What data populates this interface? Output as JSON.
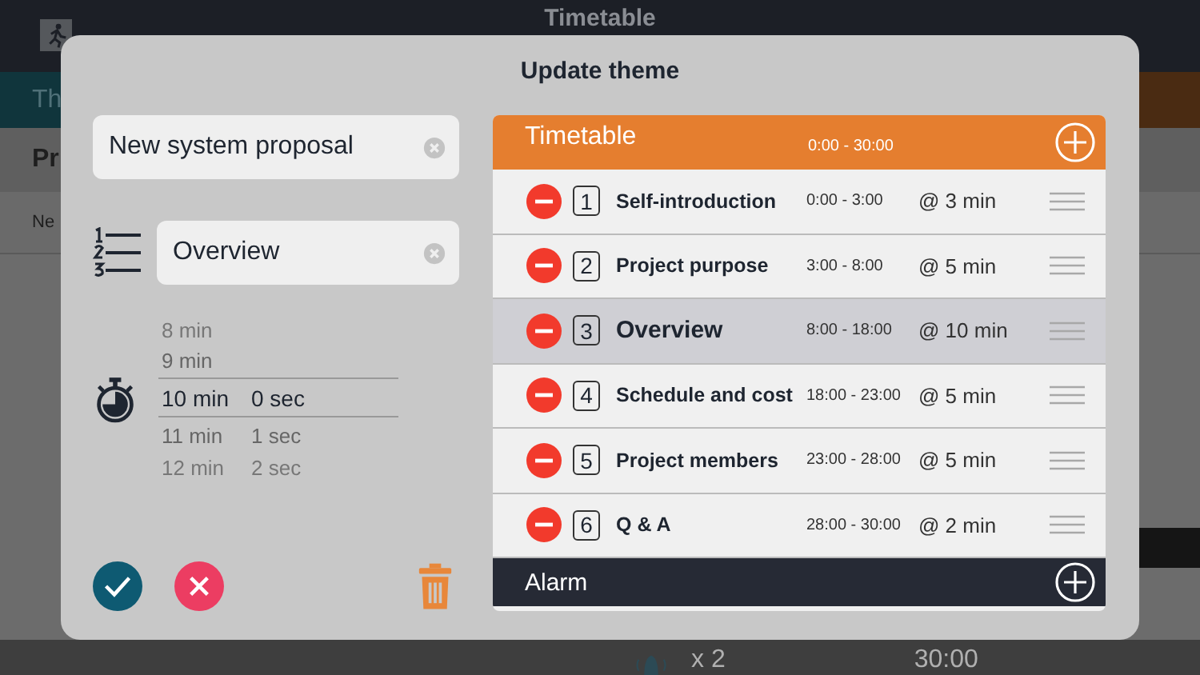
{
  "background": {
    "title": "Timetable",
    "tab": "Th",
    "row_title": "Pr",
    "row_text": "Ne",
    "footer": {
      "count": "x 2",
      "time": "30:00"
    }
  },
  "dialog": {
    "title": "Update theme",
    "name_field": {
      "value": "New system proposal"
    },
    "section_field": {
      "value": "Overview"
    },
    "picker": [
      {
        "minutes": "8 min",
        "selected": false
      },
      {
        "minutes": "9 min",
        "selected": false
      },
      {
        "minutes": "10 min",
        "seconds": "0 sec",
        "selected": true
      },
      {
        "minutes": "11 min",
        "seconds": "1 sec",
        "selected": false
      },
      {
        "minutes": "12 min",
        "seconds": "2 sec",
        "selected": false
      }
    ],
    "timetable": {
      "title": "Timetable",
      "range": "0:00 - 30:00",
      "items": [
        {
          "number": "1",
          "title": "Self-introduction",
          "range": "0:00 - 3:00",
          "alarm": "@ 3 min",
          "selected": false
        },
        {
          "number": "2",
          "title": "Project purpose",
          "range": "3:00 - 8:00",
          "alarm": "@ 5 min",
          "selected": false
        },
        {
          "number": "3",
          "title": "Overview",
          "range": "8:00 - 18:00",
          "alarm": "@ 10 min",
          "selected": true
        },
        {
          "number": "4",
          "title": "Schedule and cost",
          "range": "18:00 - 23:00",
          "alarm": "@ 5 min",
          "selected": false
        },
        {
          "number": "5",
          "title": "Project members",
          "range": "23:00 - 28:00",
          "alarm": "@ 5 min",
          "selected": false
        },
        {
          "number": "6",
          "title": "Q & A",
          "range": "28:00 - 30:00",
          "alarm": "@ 2 min",
          "selected": false
        }
      ],
      "alarm_title": "Alarm"
    }
  }
}
